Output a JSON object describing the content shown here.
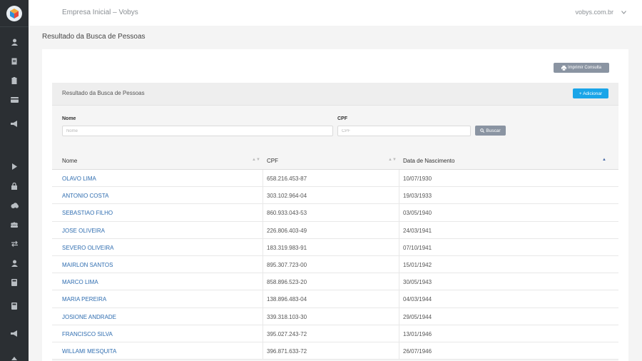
{
  "app": {
    "title": "Empresa Inicial – Vobys",
    "user_domain": "vobys.com.br"
  },
  "sidebar": {
    "icons": [
      "user-icon",
      "document-icon",
      "clipboard-icon",
      "card-icon",
      "megaphone-icon",
      "play-icon",
      "lock-icon",
      "cloud-icon",
      "group-icon",
      "exchange-icon",
      "user-icon",
      "calculator-icon",
      "calculator-icon",
      "megaphone-icon"
    ]
  },
  "page": {
    "title": "Resultado da Busca de Pessoas",
    "print_label": "Imprimir Consulta"
  },
  "panel": {
    "title": "Resultado da Busca de Pessoas",
    "add_label": "+ Adicionar"
  },
  "filters": {
    "name_label": "Nome",
    "name_placeholder": "Nome",
    "cpf_label": "CPF",
    "cpf_placeholder": "CPF",
    "search_label": "Buscar"
  },
  "table": {
    "headers": [
      "Nome",
      "CPF",
      "Data de Nascimento"
    ],
    "rows": [
      {
        "name": "OLAVO LIMA",
        "cpf": "658.216.453-87",
        "birth": "10/07/1930"
      },
      {
        "name": "ANTONIO COSTA",
        "cpf": "303.102.964-04",
        "birth": "19/03/1933"
      },
      {
        "name": "SEBASTIAO FILHO",
        "cpf": "860.933.043-53",
        "birth": "03/05/1940"
      },
      {
        "name": "JOSE OLIVEIRA",
        "cpf": "226.806.403-49",
        "birth": "24/03/1941"
      },
      {
        "name": "SEVERO OLIVEIRA",
        "cpf": "183.319.983-91",
        "birth": "07/10/1941"
      },
      {
        "name": "MAIRLON SANTOS",
        "cpf": "895.307.723-00",
        "birth": "15/01/1942"
      },
      {
        "name": "MARCO LIMA",
        "cpf": "858.896.523-20",
        "birth": "30/05/1943"
      },
      {
        "name": "MARIA PEREIRA",
        "cpf": "138.896.483-04",
        "birth": "04/03/1944"
      },
      {
        "name": "JOSIONE ANDRADE",
        "cpf": "339.318.103-30",
        "birth": "29/05/1944"
      },
      {
        "name": "FRANCISCO SILVA",
        "cpf": "395.027.243-72",
        "birth": "13/01/1946"
      },
      {
        "name": "WILLAMI MESQUITA",
        "cpf": "396.871.633-72",
        "birth": "26/07/1946"
      }
    ]
  },
  "colors": {
    "sidebar": "#2b2f33",
    "link": "#2f6db0",
    "primary_button": "#1aa5e8",
    "secondary_button": "#8a94a2"
  }
}
